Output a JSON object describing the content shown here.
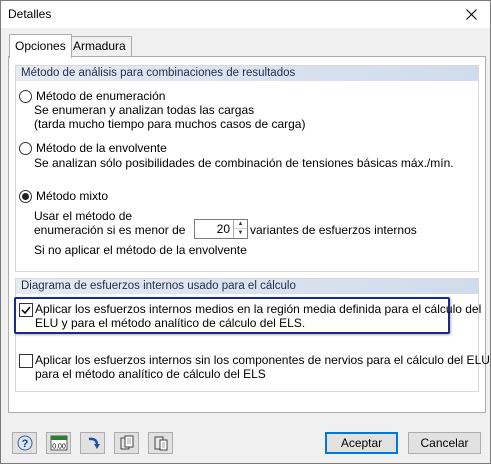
{
  "window": {
    "title": "Detalles"
  },
  "tabs": [
    {
      "label": "Opciones",
      "active": true
    },
    {
      "label": "Armadura",
      "active": false
    }
  ],
  "analysis_group": {
    "header": "Método de análisis para combinaciones de resultados",
    "enumeration": {
      "label": "Método de enumeración",
      "desc1": "Se enumeran y analizan todas las cargas",
      "desc2": "(tarda mucho tiempo para muchos casos de carga)",
      "checked": false
    },
    "envelope": {
      "label": "Método de la envolvente",
      "desc": "Se analizan sólo posibilidades de combinación de tensiones básicas máx./mín.",
      "checked": false
    },
    "mixed": {
      "label": "Método mixto",
      "checked": true,
      "line1": "Usar el método de",
      "line2": "enumeración si es menor de",
      "spinner_value": "20",
      "suffix": "variantes de esfuerzos internos",
      "else_text": "Si no aplicar el método de la envolvente"
    }
  },
  "diagram_group": {
    "header": "Diagrama de esfuerzos internos usado para el cálculo",
    "option1": {
      "line1": "Aplicar los esfuerzos internos medios en la región media definida para el cálculo del",
      "line2": "ELU y para el método analítico de cálculo del ELS.",
      "checked": true
    },
    "option2": {
      "line1": "Aplicar los esfuerzos internos sin los componentes de nervios para el cálculo del ELU y",
      "line2": "para el método analítico de cálculo del ELS",
      "checked": false
    }
  },
  "footer": {
    "icons": [
      "help-icon",
      "units-icon",
      "undo-icon",
      "copy-icon",
      "paste-icon"
    ],
    "units_label": "0.00",
    "accept_label": "Aceptar",
    "cancel_label": "Cancelar"
  },
  "colors": {
    "accent": "#0078d7",
    "highlight": "#1d2a8c"
  }
}
